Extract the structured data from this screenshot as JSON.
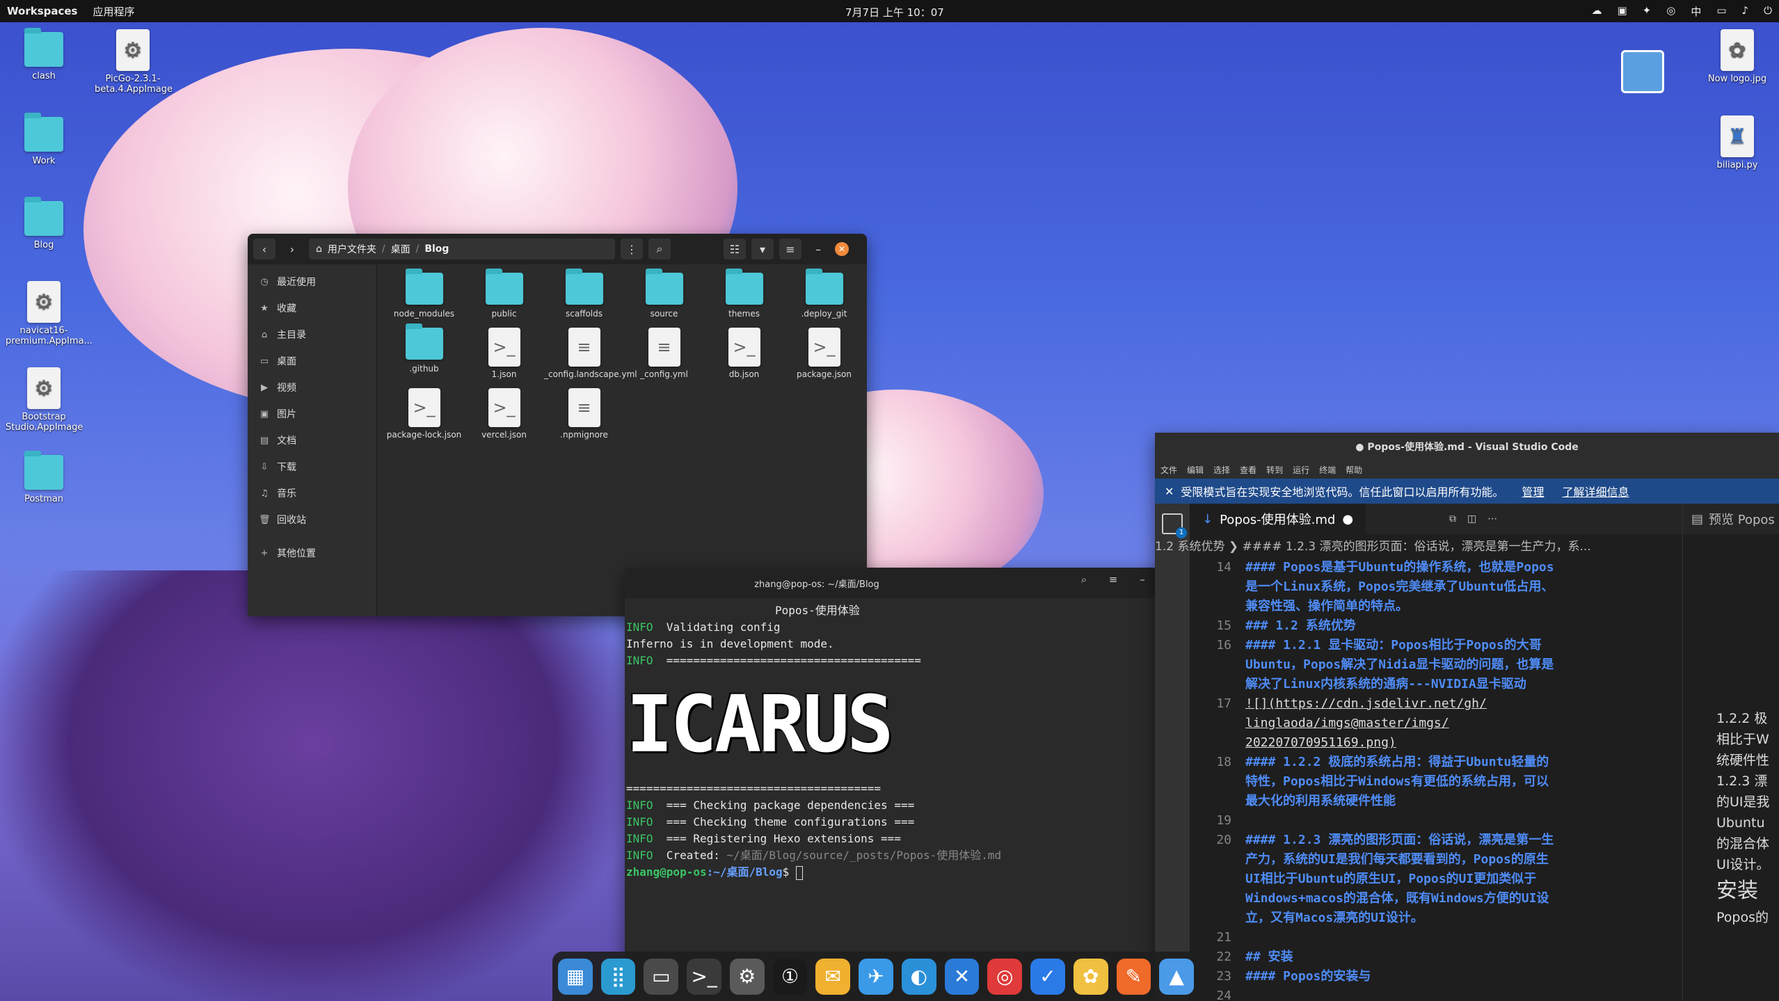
{
  "topbar": {
    "workspaces": "Workspaces",
    "apps": "应用程序",
    "clock": "7月7日 上午 10：07",
    "input_method": "中"
  },
  "desktop_icons": [
    {
      "label": "clash",
      "kind": "folder"
    },
    {
      "label": "Work",
      "kind": "folder"
    },
    {
      "label": "Blog",
      "kind": "folder"
    },
    {
      "label": "navicat16-premium.AppIma...",
      "kind": "appimage"
    },
    {
      "label": "Bootstrap Studio.AppImage",
      "kind": "appimage"
    },
    {
      "label": "Postman",
      "kind": "folder"
    },
    {
      "label": "PicGo-2.3.1-beta.4.AppImage",
      "kind": "appimage"
    },
    {
      "label": "Now logo.jpg",
      "kind": "image"
    },
    {
      "label": "biliapi.py",
      "kind": "python"
    }
  ],
  "file_manager": {
    "breadcrumb": [
      "用户文件夹",
      "桌面",
      "Blog"
    ],
    "sidebar": [
      "最近使用",
      "收藏",
      "主目录",
      "桌面",
      "视频",
      "图片",
      "文档",
      "下载",
      "音乐",
      "回收站",
      "其他位置"
    ],
    "files": [
      {
        "name": "node_modules",
        "kind": "folder"
      },
      {
        "name": "public",
        "kind": "folder"
      },
      {
        "name": "scaffolds",
        "kind": "folder"
      },
      {
        "name": "source",
        "kind": "folder"
      },
      {
        "name": "themes",
        "kind": "folder"
      },
      {
        "name": ".deploy_git",
        "kind": "folder"
      },
      {
        "name": ".github",
        "kind": "folder"
      },
      {
        "name": "1.json",
        "kind": "code"
      },
      {
        "name": "_config.landscape.yml",
        "kind": "text"
      },
      {
        "name": "_config.yml",
        "kind": "text"
      },
      {
        "name": "db.json",
        "kind": "code"
      },
      {
        "name": "package.json",
        "kind": "code"
      },
      {
        "name": "package-lock.json",
        "kind": "code"
      },
      {
        "name": "vercel.json",
        "kind": "code"
      },
      {
        "name": ".npmignore",
        "kind": "text"
      }
    ]
  },
  "terminal": {
    "title": "zhang@pop-os: ~/桌面/Blog",
    "first_line": "Popos-使用体验",
    "lines": [
      {
        "tag": "INFO",
        "text": "  Validating config"
      },
      {
        "tag": "",
        "text": "Inferno is in development mode."
      },
      {
        "tag": "INFO",
        "text": "  ======================================"
      },
      {
        "tag": "",
        "text": "======================================"
      },
      {
        "tag": "INFO",
        "text": "  === Checking package dependencies ==="
      },
      {
        "tag": "INFO",
        "text": "  === Checking theme configurations ==="
      },
      {
        "tag": "INFO",
        "text": "  === Registering Hexo extensions ==="
      }
    ],
    "banner": "ICARUS",
    "created_label": "  Created: ",
    "created_path": "~/桌面/Blog/source/_posts/Popos-使用体验.md",
    "prompt_user": "zhang@pop-os",
    "prompt_path": ":~/桌面/Blog",
    "prompt_symbol": "$ "
  },
  "vscode": {
    "title": "● Popos-使用体验.md - Visual Studio Code",
    "menu": [
      "文件",
      "编辑",
      "选择",
      "查看",
      "转到",
      "运行",
      "终端",
      "帮助"
    ],
    "banner_text": "受限模式旨在实现安全地浏览代码。信任此窗口以启用所有功能。",
    "banner_manage": "管理",
    "banner_learn": "了解详细信息",
    "tab_label": "Popos-使用体验.md",
    "preview_tab": "预览 Popos",
    "breadcrumb": "1.2 系统优势 ❯ #### 1.2.3 漂亮的图形页面：俗话说，漂亮是第一生产力，系...",
    "lines": [
      {
        "n": "14",
        "text": "#### Popos是基于Ubuntu的操作系统，也就是Popos"
      },
      {
        "n": "",
        "text": "是一个Linux系统，Popos完美继承了Ubuntu低占用、"
      },
      {
        "n": "",
        "text": "兼容性强、操作简单的特点。"
      },
      {
        "n": "15",
        "text": "### 1.2 系统优势"
      },
      {
        "n": "16",
        "text": "#### 1.2.1 显卡驱动：Popos相比于Popos的大哥"
      },
      {
        "n": "",
        "text": "Ubuntu，Popos解决了Nidia显卡驱动的问题，也算是"
      },
      {
        "n": "",
        "text": "解决了Linux内核系统的通病---NVIDIA显卡驱动"
      },
      {
        "n": "17",
        "text": "![](https://cdn.jsdelivr.net/gh/"
      },
      {
        "n": "",
        "text": "linglaoda/imgs@master/imgs/"
      },
      {
        "n": "",
        "text": "202207070951169.png)"
      },
      {
        "n": "18",
        "text": "#### 1.2.2 极底的系统占用：得益于Ubuntu轻量的"
      },
      {
        "n": "",
        "text": "特性，Popos相比于Windows有更低的系统占用，可以"
      },
      {
        "n": "",
        "text": "最大化的利用系统硬件性能"
      },
      {
        "n": "19",
        "text": ""
      },
      {
        "n": "20",
        "text": "#### 1.2.3 漂亮的图形页面：俗话说，漂亮是第一生"
      },
      {
        "n": "",
        "text": "产力，系统的UI是我们每天都要看到的，Popos的原生"
      },
      {
        "n": "",
        "text": "UI相比于Ubuntu的原生UI，Popos的UI更加类似于"
      },
      {
        "n": "",
        "text": "Windows+macos的混合体，既有Windows方便的UI设"
      },
      {
        "n": "",
        "text": "立，又有Macos漂亮的UI设计。"
      },
      {
        "n": "21",
        "text": ""
      },
      {
        "n": "22",
        "text": "## 安装"
      },
      {
        "n": "23",
        "text": "#### Popos的安装与"
      },
      {
        "n": "24",
        "text": ""
      }
    ],
    "preview_lines": [
      "1.2.2 极",
      "相比于W",
      "统硬件性",
      "1.2.3 漂",
      "的UI是我",
      "Ubuntu",
      "的混合体",
      "UI设计。",
      "安装",
      "Popos的"
    ]
  },
  "dock": [
    "files-icon",
    "app-grid-icon",
    "file-manager-icon",
    "terminal-icon",
    "settings-icon",
    "password-icon",
    "mail-icon",
    "feishu-icon",
    "edge-icon",
    "vscode-icon",
    "netease-music-icon",
    "dingtalk-icon",
    "baidu-icon",
    "sketch-icon",
    "image-viewer-icon"
  ]
}
